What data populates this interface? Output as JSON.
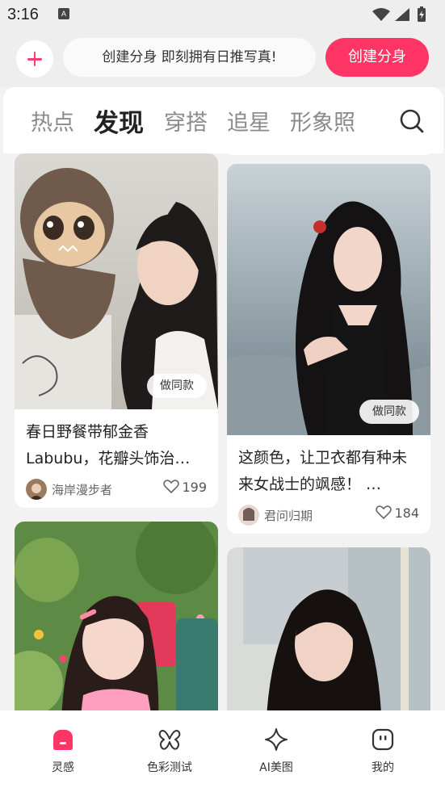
{
  "status": {
    "time": "3:16",
    "notification_letter": "A"
  },
  "create": {
    "promo_text": "创建分身 即刻拥有日推写真!",
    "button_label": "创建分身"
  },
  "tabs": [
    {
      "label": "热点",
      "active": false
    },
    {
      "label": "发现",
      "active": true
    },
    {
      "label": "穿搭",
      "active": false
    },
    {
      "label": "追星",
      "active": false
    },
    {
      "label": "形象照",
      "active": false
    }
  ],
  "feed": {
    "same_style_label": "做同款",
    "cards": [
      {
        "title": "春日野餐带郁金香Labubu，花瓣头饰治…",
        "author": "海岸漫步者",
        "likes": "199"
      },
      {
        "title": "这颜色，让卫衣都有种未来女战士的飒感！ …",
        "author": "君问归期",
        "likes": "184"
      }
    ]
  },
  "nav": [
    {
      "label": "灵感",
      "icon": "inspiration-icon",
      "active": true
    },
    {
      "label": "色彩测试",
      "icon": "butterfly-icon",
      "active": false
    },
    {
      "label": "AI美图",
      "icon": "sparkle-icon",
      "active": false
    },
    {
      "label": "我的",
      "icon": "profile-face-icon",
      "active": false
    }
  ],
  "colors": {
    "accent": "#ff3566",
    "tab_inactive": "#8a8a8a",
    "page_bg": "#f2f2f3"
  }
}
